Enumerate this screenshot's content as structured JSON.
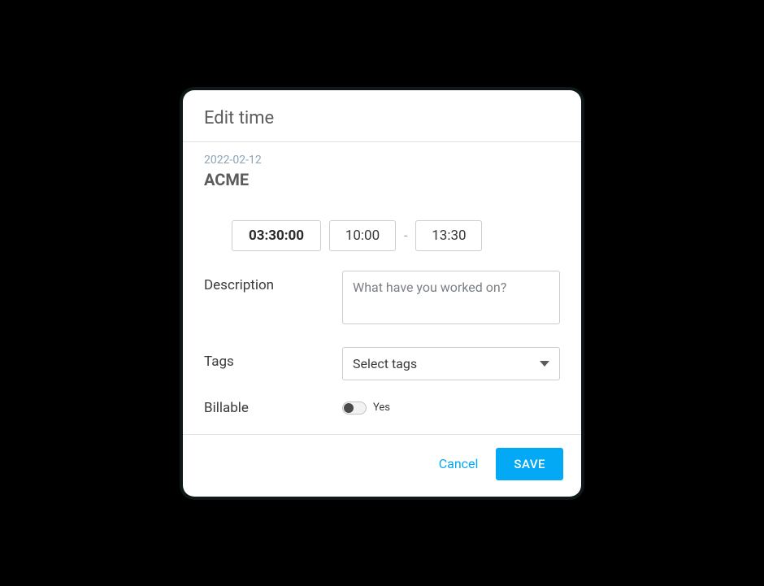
{
  "dialog": {
    "title": "Edit time",
    "date": "2022-02-12",
    "project": "ACME",
    "duration": "03:30:00",
    "start_time": "10:00",
    "time_separator": "-",
    "end_time": "13:30",
    "description": {
      "label": "Description",
      "placeholder": "What have you worked on?",
      "value": ""
    },
    "tags": {
      "label": "Tags",
      "placeholder": "Select tags"
    },
    "billable": {
      "label": "Billable",
      "value_text": "Yes",
      "enabled": false
    },
    "actions": {
      "cancel": "Cancel",
      "save": "SAVE"
    }
  }
}
